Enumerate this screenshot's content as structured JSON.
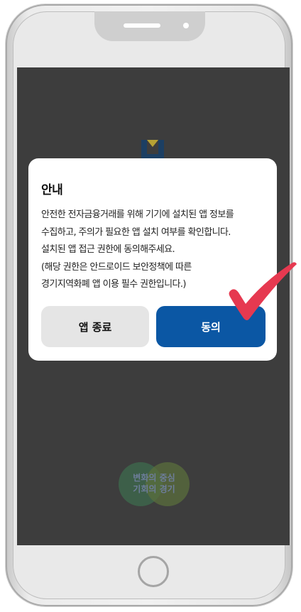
{
  "dialog": {
    "title": "안내",
    "lines": [
      "안전한 전자금융거래를 위해 기기에 설치된 앱 정보를",
      "수집하고, 주의가 필요한 앱 설치 여부를 확인합니다.",
      "설치된 앱 접근 권한에 동의해주세요.",
      "(해당 권한은 안드로이드 보안정책에 따른",
      "경기지역화폐 앱 이용 필수 권한입니다.)"
    ],
    "exit_button": "앱 종료",
    "agree_button": "동의"
  },
  "background": {
    "slogan_line1": "변화의 중심",
    "slogan_line2": "기회의 경기"
  },
  "colors": {
    "screen_overlay": "#3d3d3d",
    "agree_button": "#0b57a4",
    "exit_button": "#e5e5e5",
    "checkmark": "#e63950"
  },
  "icons": {
    "logo": "gyeonggi-logo-icon",
    "checkmark": "checkmark-icon",
    "home": "home-button"
  }
}
